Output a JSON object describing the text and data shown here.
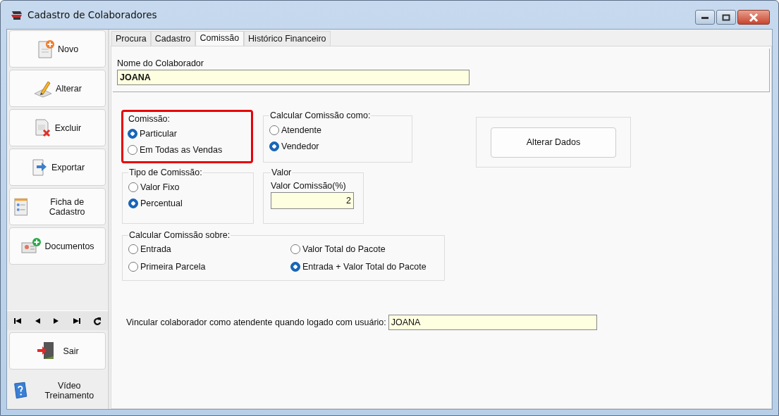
{
  "window": {
    "title": "Cadastro de Colaboradores"
  },
  "sidebar": {
    "buttons": [
      {
        "label": "Novo"
      },
      {
        "label": "Alterar"
      },
      {
        "label": "Excluir"
      },
      {
        "label": "Exportar"
      },
      {
        "label": "Ficha de Cadastro"
      },
      {
        "label": "Documentos"
      }
    ],
    "bottom_buttons": [
      {
        "label": "Sair"
      },
      {
        "label": "Vídeo Treinamento"
      }
    ]
  },
  "tabs": [
    {
      "label": "Procura",
      "selected": false
    },
    {
      "label": "Cadastro",
      "selected": false
    },
    {
      "label": "Comissão",
      "selected": true
    },
    {
      "label": "Histórico Financeiro",
      "selected": false
    }
  ],
  "name_field": {
    "label": "Nome do Colaborador",
    "value": "JOANA"
  },
  "comissao": {
    "title": "Comissão:",
    "highlighted": true,
    "options": [
      {
        "label": "Particular",
        "selected": true
      },
      {
        "label": "Em Todas as Vendas",
        "selected": false
      }
    ]
  },
  "calcular_como": {
    "title": "Calcular Comissão como:",
    "highlighted": false,
    "options": [
      {
        "label": "Atendente",
        "selected": false
      },
      {
        "label": "Vendedor",
        "selected": true
      }
    ]
  },
  "alterar_dados": {
    "button": "Alterar Dados"
  },
  "tipo_comissao": {
    "title": "Tipo de Comissão:",
    "highlighted": false,
    "options": [
      {
        "label": "Valor Fixo",
        "selected": false
      },
      {
        "label": "Percentual",
        "selected": true
      }
    ]
  },
  "valor": {
    "title": "Valor",
    "field_label": "Valor Comissão(%)",
    "value": "2"
  },
  "calcular_sobre": {
    "title": "Calcular Comissão sobre:",
    "highlighted": false,
    "options": [
      {
        "label": "Entrada",
        "selected": false
      },
      {
        "label": "Valor Total do Pacote",
        "selected": false
      },
      {
        "label": "Primeira Parcela",
        "selected": false
      },
      {
        "label": "Entrada + Valor Total do Pacote",
        "selected": true
      }
    ]
  },
  "vincular": {
    "label": "Vincular colaborador como atendente quando logado com usuário:",
    "value": "JOANA"
  }
}
